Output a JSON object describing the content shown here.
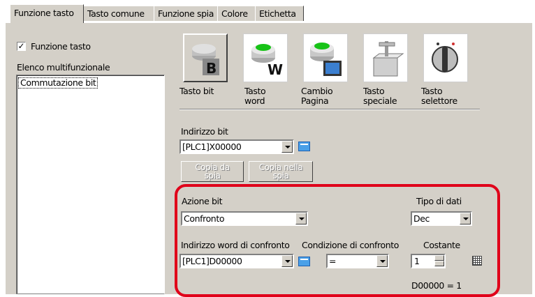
{
  "tabs": [
    {
      "label": "Funzione tasto",
      "active": true
    },
    {
      "label": "Tasto comune",
      "active": false
    },
    {
      "label": "Funzione spia",
      "active": false
    },
    {
      "label": "Colore",
      "active": false
    },
    {
      "label": "Etichetta",
      "active": false
    }
  ],
  "left": {
    "checkbox_label": "Funzione tasto",
    "checkbox_checked": true,
    "list_title": "Elenco multifunzionale",
    "list_items": [
      "Commutazione bit"
    ]
  },
  "icons": [
    {
      "label": "Tasto bit",
      "icon": "bit-switch-icon"
    },
    {
      "label": "Tasto\nword",
      "icon": "word-switch-icon"
    },
    {
      "label": "Cambio\nPagina",
      "icon": "change-screen-icon"
    },
    {
      "label": "Tasto\nspeciale",
      "icon": "special-switch-icon"
    },
    {
      "label": "Tasto\nselettore",
      "icon": "selector-switch-icon"
    }
  ],
  "bit_address": {
    "label": "Indirizzo bit",
    "value": "[PLC1]X00000"
  },
  "buttons": {
    "copy_from_lamp": "Copia da\nspia",
    "copy_to_lamp": "Copia nella\nspia"
  },
  "bit_action": {
    "label": "Azione bit",
    "value": "Confronto"
  },
  "data_type": {
    "label": "Tipo di dati",
    "value": "Dec"
  },
  "compare_word_address": {
    "label": "Indirizzo word di confronto",
    "value": "[PLC1]D00000"
  },
  "compare_condition": {
    "label": "Condizione di confronto",
    "value": "="
  },
  "constant": {
    "label": "Costante",
    "value": "1"
  },
  "status": "D00000 = 1",
  "colors": {
    "highlight": "#e0001a",
    "dialog_bg": "#d4d0c8"
  }
}
